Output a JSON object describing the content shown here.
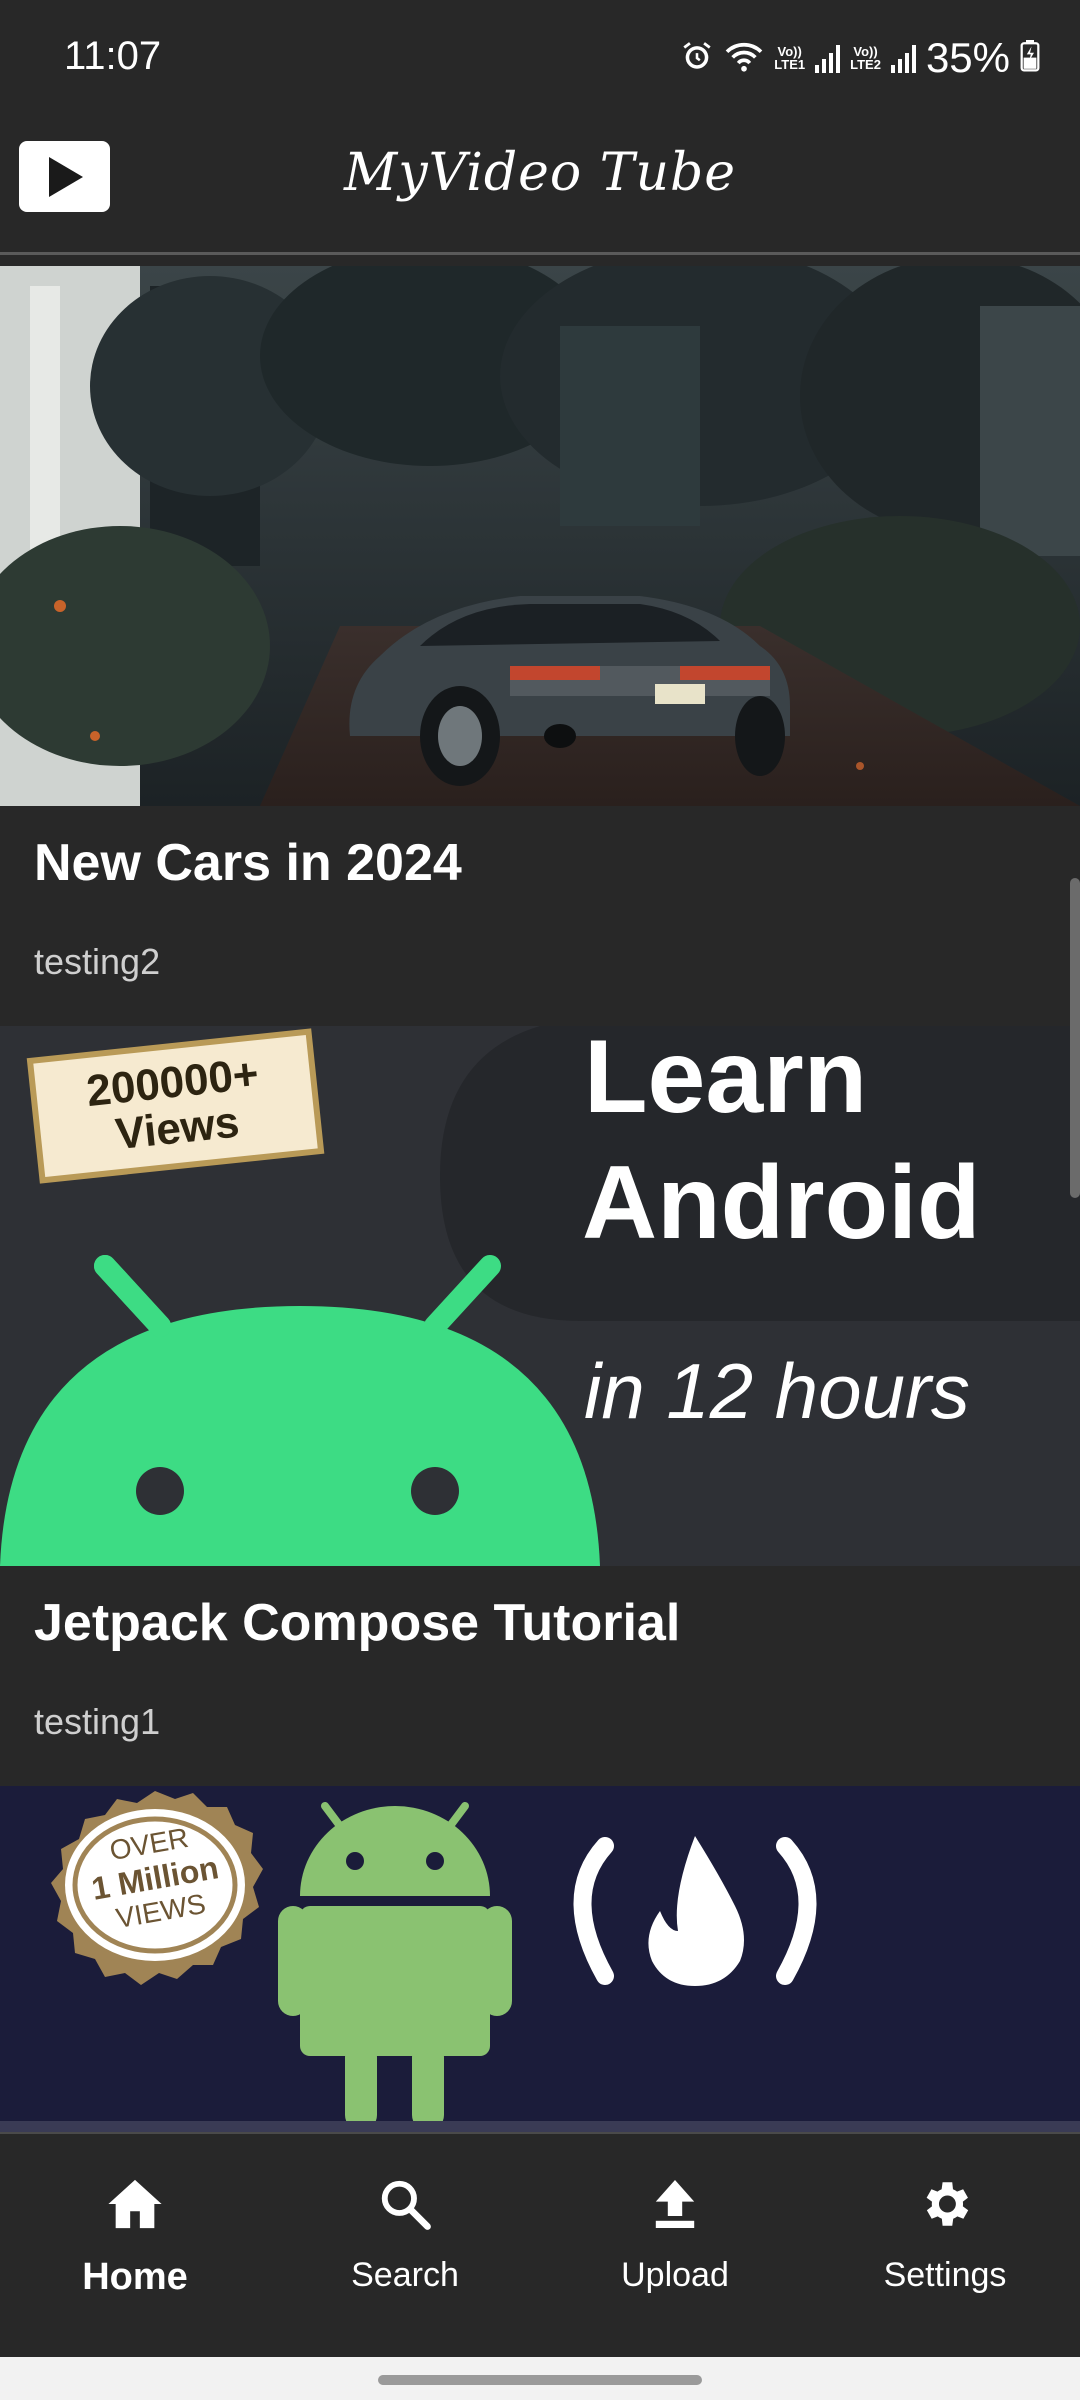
{
  "status_bar": {
    "time": "11:07",
    "battery": "35%",
    "sim1": "LTE1",
    "sim2": "LTE2"
  },
  "app_bar": {
    "title": "MyVideo Tube",
    "logo_icon": "play-icon"
  },
  "videos": [
    {
      "title": "New Cars in 2024",
      "channel": "testing2",
      "thumbnail": "sports-car-photo"
    },
    {
      "title": "Jetpack Compose Tutorial",
      "channel": "testing1",
      "thumbnail": "learn-android-banner",
      "thumb_text": {
        "badge_line1": "200000+",
        "badge_line2": "Views",
        "heading1": "Learn",
        "heading2": "Android",
        "subheading": "in 12 hours"
      }
    },
    {
      "thumbnail": "android-development-banner",
      "thumb_text": {
        "seal_line1": "OVER",
        "seal_line2": "1 Million",
        "seal_line3": "VIEWS"
      }
    }
  ],
  "bottom_nav": [
    {
      "label": "Home",
      "icon": "home-icon",
      "active": true
    },
    {
      "label": "Search",
      "icon": "search-icon",
      "active": false
    },
    {
      "label": "Upload",
      "icon": "upload-icon",
      "active": false
    },
    {
      "label": "Settings",
      "icon": "gear-icon",
      "active": false
    }
  ],
  "colors": {
    "background": "#282828",
    "android_green": "#3ddc84",
    "banner_dark": "#2e3035",
    "banner_navy": "#1b1c3a"
  }
}
